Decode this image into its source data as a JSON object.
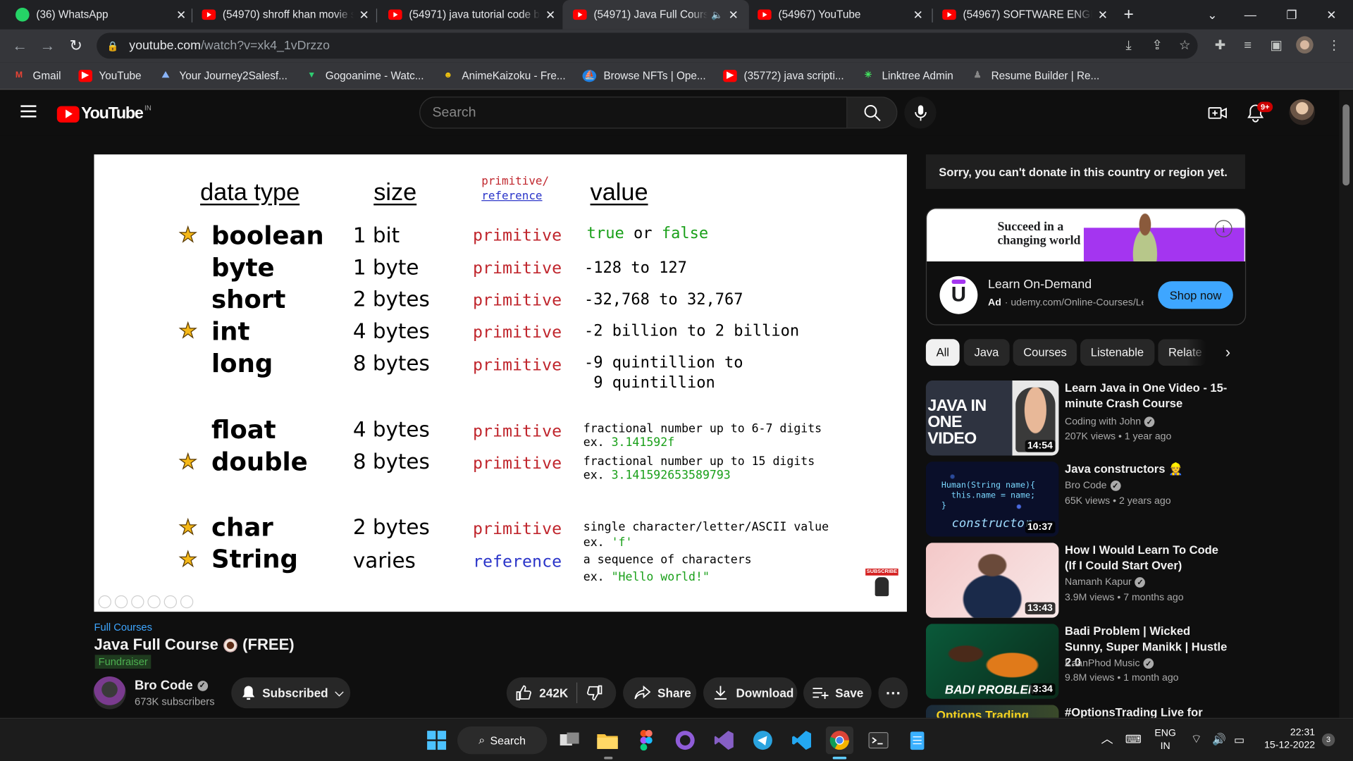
{
  "tabs": [
    {
      "label": "(36) WhatsApp",
      "favicon": "whatsapp-icon"
    },
    {
      "label": "(54970) shroff khan movie s",
      "favicon": "youtube-icon"
    },
    {
      "label": "(54971) java tutorial code b",
      "favicon": "youtube-icon"
    },
    {
      "label": "(54971) Java Full Course",
      "favicon": "youtube-icon",
      "active": true
    },
    {
      "label": "(54967) YouTube",
      "favicon": "youtube-icon"
    },
    {
      "label": "(54967) SOFTWARE ENGINE",
      "favicon": "youtube-icon"
    }
  ],
  "address": {
    "host": "youtube.com",
    "path": "/watch?v=xk4_1vDrzzo"
  },
  "bookmarks": [
    {
      "label": "Gmail",
      "icon": "gmail-icon",
      "color": "#ea4335"
    },
    {
      "label": "YouTube",
      "icon": "youtube-icon",
      "color": "#ff0000"
    },
    {
      "label": "Your Journey2Salesf...",
      "icon": "trailhead-icon",
      "color": "#8ab4f8"
    },
    {
      "label": "Gogoanime - Watc...",
      "icon": "gogoanime-icon",
      "color": "#2ecc71"
    },
    {
      "label": "AnimeKaizoku - Fre...",
      "icon": "animekaizoku-icon",
      "color": "#f1c40f"
    },
    {
      "label": "Browse NFTs | Ope...",
      "icon": "opensea-icon",
      "color": "#2081e2"
    },
    {
      "label": "(35772) java scripti...",
      "icon": "youtube-icon",
      "color": "#ff0000"
    },
    {
      "label": "Linktree Admin",
      "icon": "linktree-icon",
      "color": "#43e660"
    },
    {
      "label": "Resume Builder | Re...",
      "icon": "resume-icon",
      "color": "#555555"
    }
  ],
  "youtube": {
    "logo_text": "YouTube",
    "country_code": "IN",
    "search_placeholder": "Search",
    "notification_badge": "9+"
  },
  "slide": {
    "headers": {
      "data_type": "data type",
      "size": "size",
      "primitive": "primitive/",
      "reference": "reference",
      "value": "value"
    },
    "rows": [
      {
        "type": "boolean",
        "size": "1 bit",
        "kind": "primitive",
        "value_parts": [
          {
            "t": "true",
            "c": "grn"
          },
          {
            "t": " or ",
            "c": ""
          },
          {
            "t": "false",
            "c": "grn"
          }
        ],
        "starred": true
      },
      {
        "type": "byte",
        "size": "1 byte",
        "kind": "primitive",
        "value": "-128 to 127"
      },
      {
        "type": "short",
        "size": "2 bytes",
        "kind": "primitive",
        "value": "-32,768 to 32,767"
      },
      {
        "type": "int",
        "size": "4 bytes",
        "kind": "primitive",
        "value": "-2 billion to 2 billion",
        "starred": true
      },
      {
        "type": "long",
        "size": "8 bytes",
        "kind": "primitive",
        "value": "-9 quintillion to",
        "value2": " 9 quintillion"
      },
      {
        "type": "float",
        "size": "4 bytes",
        "kind": "primitive",
        "value": "fractional number up to 6-7 digits",
        "ex_prefix": "ex. ",
        "ex": "3.141592f"
      },
      {
        "type": "double",
        "size": "8 bytes",
        "kind": "primitive",
        "value": "fractional number up to 15 digits",
        "ex_prefix": "ex. ",
        "ex": "3.141592653589793",
        "starred": true
      },
      {
        "type": "char",
        "size": "2 bytes",
        "kind": "primitive",
        "value": "single character/letter/ASCII value",
        "ex_prefix": "ex. ",
        "ex": "'f'",
        "starred": true
      },
      {
        "type": "String",
        "size": "varies",
        "kind": "reference",
        "value": "a sequence of characters",
        "ex_prefix": "ex. ",
        "ex": "\"Hello world!\"",
        "starred": true
      }
    ],
    "subscribe_badge": "SUBSCRIBE"
  },
  "video": {
    "category": "Full Courses",
    "title": "Java Full Course",
    "title_suffix": "(FREE)",
    "fundraiser": "Fundraiser",
    "channel": "Bro Code",
    "subscribers": "673K subscribers",
    "subscribed_label": "Subscribed",
    "likes": "242K",
    "share": "Share",
    "download": "Download",
    "save": "Save"
  },
  "sidebar": {
    "donate_notice": "Sorry, you can't donate in this country or region yet.",
    "ad": {
      "banner_line1": "Succeed in a",
      "banner_line2": "changing world",
      "title": "Learn On-Demand",
      "ad_label": "Ad",
      "domain": "udemy.com/Online-Courses/Lear",
      "cta": "Shop now",
      "logo_letter": "U"
    },
    "chips": [
      "All",
      "Java",
      "Courses",
      "Listenable",
      "Relate"
    ],
    "recommendations": [
      {
        "title": "Learn Java in One Video - 15-minute Crash Course",
        "channel": "Coding with John",
        "verified": true,
        "meta": "207K views  • 1 year ago",
        "duration": "14:54",
        "thumb_text": "JAVA IN ONE VIDEO"
      },
      {
        "title": "Java constructors 👷",
        "channel": "Bro Code",
        "verified": true,
        "meta": "65K views  • 2 years ago",
        "duration": "10:37",
        "thumb_code": "Human(String name){\n  this.name = name;\n}",
        "thumb_text": "constructor"
      },
      {
        "title": "How I Would Learn To Code (If I Could Start Over)",
        "channel": "Namanh Kapur",
        "verified": true,
        "meta": "3.9M views  • 7 months ago",
        "duration": "13:43"
      },
      {
        "title": "Badi Problem | Wicked Sunny, Super Manikk | Hustle 2.0",
        "channel": "KaanPhod Music",
        "verified": true,
        "meta": "9.8M views  • 1 month ago",
        "duration": "3:34",
        "thumb_text": "BADI PROBLEM"
      },
      {
        "title": "#OptionsTrading Live for",
        "thumb_text": "Options Trading"
      }
    ]
  },
  "taskbar": {
    "search_label": "Search",
    "lang_line1": "ENG",
    "lang_line2": "IN",
    "time": "22:31",
    "date": "15-12-2022",
    "notif_count": "3"
  }
}
